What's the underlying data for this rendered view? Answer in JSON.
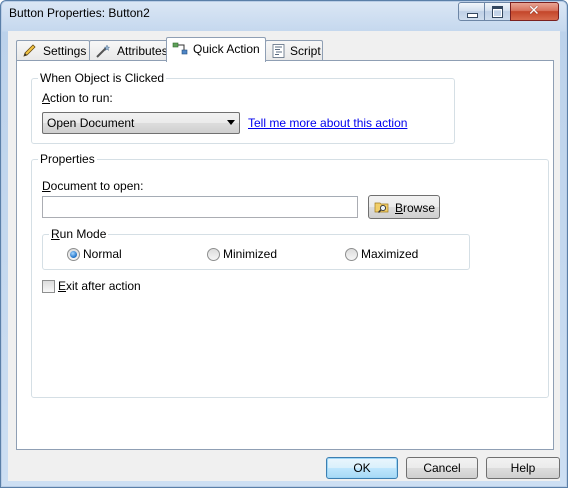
{
  "window": {
    "title": "Button Properties: Button2",
    "close_glyph": "✕"
  },
  "tabs": [
    {
      "label": "Settings",
      "icon": "pencil-icon",
      "active": false
    },
    {
      "label": "Attributes",
      "icon": "magic-wand-icon",
      "active": false
    },
    {
      "label": "Quick Action",
      "icon": "flowchart-icon",
      "active": true
    },
    {
      "label": "Script",
      "icon": "script-icon",
      "active": false
    }
  ],
  "when_clicked": {
    "legend": "When Object is Clicked",
    "action_label": "Action to run:",
    "action_value": "Open Document",
    "help_link": "Tell me more about this action"
  },
  "properties": {
    "legend": "Properties",
    "document_label": "Document to open:",
    "document_value": "",
    "browse_label": "Browse",
    "run_mode": {
      "legend": "Run Mode",
      "options": [
        "Normal",
        "Minimized",
        "Maximized"
      ],
      "selected": "Normal"
    },
    "exit_label": "Exit after action",
    "exit_checked": false
  },
  "footer": {
    "ok": "OK",
    "cancel": "Cancel",
    "help": "Help"
  },
  "colors": {
    "link": "#0000ee",
    "title_bar": "#c5d8ee",
    "close_button": "#c4462a",
    "default_button_border": "#3c7fb1"
  }
}
